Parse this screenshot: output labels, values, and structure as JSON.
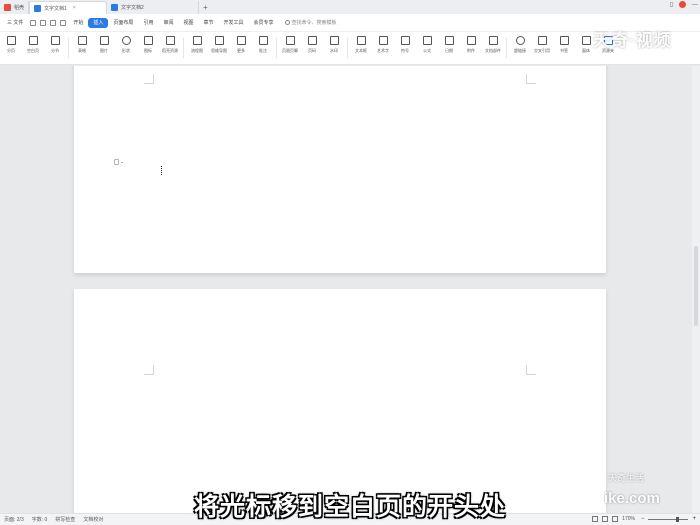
{
  "tabs": [
    {
      "label": "稻壳",
      "badge_color": "#e94b3c",
      "active": false
    },
    {
      "label": "文字文档1",
      "badge_color": "#2b7be4",
      "active": true
    },
    {
      "label": "文字文档2",
      "badge_color": "#2b7be4",
      "active": false
    }
  ],
  "tab_add": "+",
  "menu": {
    "file": "三 文件",
    "items": [
      "开始",
      "插入",
      "页面布局",
      "引用",
      "审阅",
      "视图",
      "章节",
      "开发工具",
      "会员专享"
    ],
    "active_index": 1,
    "search": "查找命令、搜索模板"
  },
  "ribbon": [
    {
      "label": "分页"
    },
    {
      "label": "空白页"
    },
    {
      "label": "分节"
    },
    {
      "label": "表格"
    },
    {
      "label": "图片"
    },
    {
      "label": "形状"
    },
    {
      "label": "图标"
    },
    {
      "label": "稻壳资源"
    },
    {
      "label": "流程图"
    },
    {
      "label": "思维导图"
    },
    {
      "label": "更多"
    },
    {
      "label": "批注"
    },
    {
      "label": "页眉页脚"
    },
    {
      "label": "页码"
    },
    {
      "label": "水印"
    },
    {
      "label": "文本框"
    },
    {
      "label": "艺术字"
    },
    {
      "label": "符号"
    },
    {
      "label": "公式"
    },
    {
      "label": "日期"
    },
    {
      "label": "附件"
    },
    {
      "label": "文档部件"
    },
    {
      "label": "超链接"
    },
    {
      "label": "交叉引用"
    },
    {
      "label": "书签"
    },
    {
      "label": "窗体"
    },
    {
      "label": "资源夹"
    }
  ],
  "watermark": {
    "top": "天奇·视频",
    "bottom_small": "天奇生活",
    "bottom_url": "ike.com"
  },
  "status": {
    "page": "页面: 2/3",
    "words": "字数: 0",
    "spell": "拼写检查",
    "proof": "文档校对",
    "zoom": "170%",
    "zoom_level": 0.7
  },
  "subtitle": "将光标移到空白页的开头处"
}
